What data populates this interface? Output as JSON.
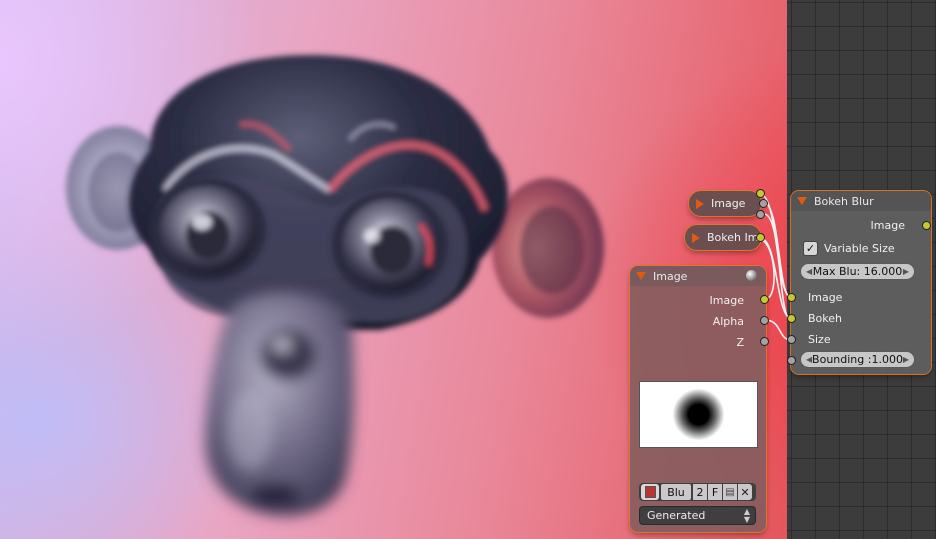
{
  "render_view": {
    "subject": "monkey-head-render"
  },
  "nodes": {
    "reroute_image": {
      "label": "Image"
    },
    "reroute_bokeh": {
      "label": "Bokeh Im"
    },
    "image_node": {
      "title": "Image",
      "outputs": [
        "Image",
        "Alpha",
        "Z"
      ],
      "image_name": "Blu",
      "users": "2",
      "fake_user": "F",
      "source": "Generated"
    },
    "bokeh_blur": {
      "title": "Bokeh Blur",
      "output": "Image",
      "variable_size_label": "Variable Size",
      "variable_size_checked": true,
      "max_blur": "Max Blu: 16.000",
      "inputs": [
        "Image",
        "Bokeh",
        "Size"
      ],
      "bounding": "Bounding :1.000"
    }
  },
  "colors": {
    "socket_color": "#c7c732",
    "socket_gray": "#a2a2a2",
    "node_outline": "#e6781e"
  }
}
